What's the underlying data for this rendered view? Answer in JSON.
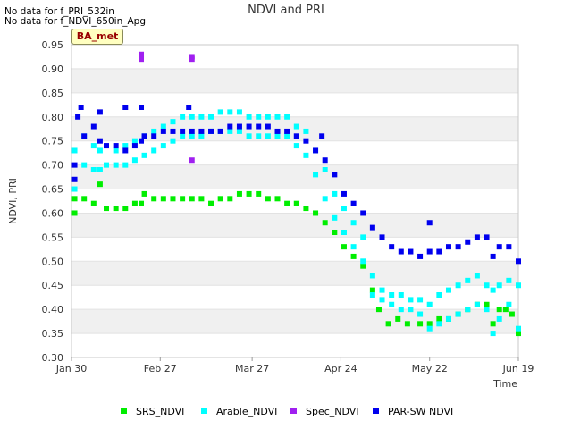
{
  "notes": [
    "No data for f_PRI_532in",
    "No data for f_NDVI_650in_Apg"
  ],
  "site_tag": "BA_met",
  "chart_data": {
    "type": "scatter",
    "title": "NDVI and PRI",
    "xlabel": "Time",
    "ylabel": "NDVI, PRI",
    "x_range": [
      "2024-01-30",
      "2024-06-19"
    ],
    "xticks": [
      {
        "label": "Jan 30",
        "date": "2024-01-30"
      },
      {
        "label": "Feb 27",
        "date": "2024-02-27"
      },
      {
        "label": "Mar 27",
        "date": "2024-03-27"
      },
      {
        "label": "Apr 24",
        "date": "2024-04-24"
      },
      {
        "label": "May 22",
        "date": "2024-05-22"
      },
      {
        "label": "Jun 19",
        "date": "2024-06-19"
      }
    ],
    "ylim": [
      0.3,
      0.95
    ],
    "yticks": [
      "0.30",
      "0.35",
      "0.40",
      "0.45",
      "0.50",
      "0.55",
      "0.60",
      "0.65",
      "0.70",
      "0.75",
      "0.80",
      "0.85",
      "0.90",
      "0.95"
    ],
    "grid": "horizontal alternating bands",
    "legend_position": "bottom",
    "series": [
      {
        "name": "SRS_NDVI",
        "color": "#00ee00",
        "points": [
          [
            "2024-01-31",
            0.6
          ],
          [
            "2024-01-31",
            0.63
          ],
          [
            "2024-02-03",
            0.63
          ],
          [
            "2024-02-06",
            0.62
          ],
          [
            "2024-02-08",
            0.66
          ],
          [
            "2024-02-10",
            0.61
          ],
          [
            "2024-02-13",
            0.61
          ],
          [
            "2024-02-16",
            0.61
          ],
          [
            "2024-02-19",
            0.62
          ],
          [
            "2024-02-21",
            0.62
          ],
          [
            "2024-02-22",
            0.64
          ],
          [
            "2024-02-25",
            0.63
          ],
          [
            "2024-02-28",
            0.63
          ],
          [
            "2024-03-02",
            0.63
          ],
          [
            "2024-03-05",
            0.63
          ],
          [
            "2024-03-08",
            0.63
          ],
          [
            "2024-03-11",
            0.63
          ],
          [
            "2024-03-14",
            0.62
          ],
          [
            "2024-03-17",
            0.63
          ],
          [
            "2024-03-20",
            0.63
          ],
          [
            "2024-03-23",
            0.64
          ],
          [
            "2024-03-26",
            0.64
          ],
          [
            "2024-03-29",
            0.64
          ],
          [
            "2024-04-01",
            0.63
          ],
          [
            "2024-04-04",
            0.63
          ],
          [
            "2024-04-07",
            0.62
          ],
          [
            "2024-04-10",
            0.62
          ],
          [
            "2024-04-13",
            0.61
          ],
          [
            "2024-04-16",
            0.6
          ],
          [
            "2024-04-19",
            0.58
          ],
          [
            "2024-04-22",
            0.56
          ],
          [
            "2024-04-25",
            0.53
          ],
          [
            "2024-04-28",
            0.51
          ],
          [
            "2024-05-01",
            0.49
          ],
          [
            "2024-05-04",
            0.44
          ],
          [
            "2024-05-06",
            0.4
          ],
          [
            "2024-05-09",
            0.37
          ],
          [
            "2024-05-12",
            0.38
          ],
          [
            "2024-05-15",
            0.37
          ],
          [
            "2024-05-19",
            0.37
          ],
          [
            "2024-05-22",
            0.37
          ],
          [
            "2024-05-25",
            0.38
          ],
          [
            "2024-05-28",
            0.38
          ],
          [
            "2024-05-31",
            0.39
          ],
          [
            "2024-06-03",
            0.4
          ],
          [
            "2024-06-06",
            0.41
          ],
          [
            "2024-06-09",
            0.41
          ],
          [
            "2024-06-11",
            0.37
          ],
          [
            "2024-06-13",
            0.4
          ],
          [
            "2024-06-15",
            0.4
          ],
          [
            "2024-06-17",
            0.39
          ],
          [
            "2024-06-19",
            0.35
          ]
        ]
      },
      {
        "name": "Arable_NDVI",
        "color": "#00ffff",
        "points": [
          [
            "2024-01-31",
            0.65
          ],
          [
            "2024-01-31",
            0.73
          ],
          [
            "2024-02-03",
            0.7
          ],
          [
            "2024-02-03",
            0.76
          ],
          [
            "2024-02-06",
            0.69
          ],
          [
            "2024-02-06",
            0.74
          ],
          [
            "2024-02-08",
            0.69
          ],
          [
            "2024-02-08",
            0.73
          ],
          [
            "2024-02-10",
            0.7
          ],
          [
            "2024-02-13",
            0.7
          ],
          [
            "2024-02-13",
            0.73
          ],
          [
            "2024-02-16",
            0.7
          ],
          [
            "2024-02-16",
            0.74
          ],
          [
            "2024-02-19",
            0.71
          ],
          [
            "2024-02-19",
            0.75
          ],
          [
            "2024-02-22",
            0.72
          ],
          [
            "2024-02-22",
            0.76
          ],
          [
            "2024-02-25",
            0.73
          ],
          [
            "2024-02-25",
            0.77
          ],
          [
            "2024-02-28",
            0.74
          ],
          [
            "2024-02-28",
            0.78
          ],
          [
            "2024-03-02",
            0.75
          ],
          [
            "2024-03-02",
            0.79
          ],
          [
            "2024-03-05",
            0.76
          ],
          [
            "2024-03-05",
            0.8
          ],
          [
            "2024-03-08",
            0.76
          ],
          [
            "2024-03-08",
            0.8
          ],
          [
            "2024-03-11",
            0.76
          ],
          [
            "2024-03-11",
            0.8
          ],
          [
            "2024-03-14",
            0.77
          ],
          [
            "2024-03-14",
            0.8
          ],
          [
            "2024-03-17",
            0.77
          ],
          [
            "2024-03-17",
            0.81
          ],
          [
            "2024-03-20",
            0.77
          ],
          [
            "2024-03-20",
            0.81
          ],
          [
            "2024-03-23",
            0.77
          ],
          [
            "2024-03-23",
            0.81
          ],
          [
            "2024-03-26",
            0.76
          ],
          [
            "2024-03-26",
            0.8
          ],
          [
            "2024-03-29",
            0.76
          ],
          [
            "2024-03-29",
            0.8
          ],
          [
            "2024-04-01",
            0.76
          ],
          [
            "2024-04-01",
            0.8
          ],
          [
            "2024-04-04",
            0.76
          ],
          [
            "2024-04-04",
            0.8
          ],
          [
            "2024-04-07",
            0.76
          ],
          [
            "2024-04-07",
            0.8
          ],
          [
            "2024-04-10",
            0.74
          ],
          [
            "2024-04-10",
            0.78
          ],
          [
            "2024-04-13",
            0.72
          ],
          [
            "2024-04-13",
            0.77
          ],
          [
            "2024-04-16",
            0.68
          ],
          [
            "2024-04-16",
            0.73
          ],
          [
            "2024-04-19",
            0.63
          ],
          [
            "2024-04-19",
            0.69
          ],
          [
            "2024-04-22",
            0.59
          ],
          [
            "2024-04-22",
            0.64
          ],
          [
            "2024-04-25",
            0.56
          ],
          [
            "2024-04-25",
            0.61
          ],
          [
            "2024-04-28",
            0.53
          ],
          [
            "2024-04-28",
            0.58
          ],
          [
            "2024-05-01",
            0.5
          ],
          [
            "2024-05-01",
            0.55
          ],
          [
            "2024-05-04",
            0.43
          ],
          [
            "2024-05-04",
            0.47
          ],
          [
            "2024-05-07",
            0.42
          ],
          [
            "2024-05-07",
            0.44
          ],
          [
            "2024-05-10",
            0.41
          ],
          [
            "2024-05-10",
            0.43
          ],
          [
            "2024-05-13",
            0.4
          ],
          [
            "2024-05-13",
            0.43
          ],
          [
            "2024-05-16",
            0.4
          ],
          [
            "2024-05-16",
            0.42
          ],
          [
            "2024-05-19",
            0.39
          ],
          [
            "2024-05-19",
            0.42
          ],
          [
            "2024-05-22",
            0.36
          ],
          [
            "2024-05-22",
            0.41
          ],
          [
            "2024-05-25",
            0.37
          ],
          [
            "2024-05-25",
            0.43
          ],
          [
            "2024-05-28",
            0.38
          ],
          [
            "2024-05-28",
            0.44
          ],
          [
            "2024-05-31",
            0.39
          ],
          [
            "2024-05-31",
            0.45
          ],
          [
            "2024-06-03",
            0.4
          ],
          [
            "2024-06-03",
            0.46
          ],
          [
            "2024-06-06",
            0.41
          ],
          [
            "2024-06-06",
            0.47
          ],
          [
            "2024-06-09",
            0.4
          ],
          [
            "2024-06-09",
            0.45
          ],
          [
            "2024-06-11",
            0.35
          ],
          [
            "2024-06-11",
            0.44
          ],
          [
            "2024-06-13",
            0.38
          ],
          [
            "2024-06-13",
            0.45
          ],
          [
            "2024-06-16",
            0.41
          ],
          [
            "2024-06-16",
            0.46
          ],
          [
            "2024-06-19",
            0.36
          ],
          [
            "2024-06-19",
            0.45
          ]
        ]
      },
      {
        "name": "Spec_NDVI",
        "color": "#a020f0",
        "points": [
          [
            "2024-02-21",
            0.92
          ],
          [
            "2024-02-21",
            0.93
          ],
          [
            "2024-03-08",
            0.92
          ],
          [
            "2024-03-08",
            0.925
          ],
          [
            "2024-03-08",
            0.71
          ]
        ]
      },
      {
        "name": "PAR-SW NDVI",
        "color": "#0000ee",
        "points": [
          [
            "2024-01-31",
            0.7
          ],
          [
            "2024-01-31",
            0.67
          ],
          [
            "2024-02-01",
            0.8
          ],
          [
            "2024-02-02",
            0.82
          ],
          [
            "2024-02-03",
            0.76
          ],
          [
            "2024-02-06",
            0.78
          ],
          [
            "2024-02-08",
            0.75
          ],
          [
            "2024-02-08",
            0.81
          ],
          [
            "2024-02-10",
            0.74
          ],
          [
            "2024-02-13",
            0.74
          ],
          [
            "2024-02-16",
            0.73
          ],
          [
            "2024-02-16",
            0.82
          ],
          [
            "2024-02-19",
            0.74
          ],
          [
            "2024-02-21",
            0.75
          ],
          [
            "2024-02-21",
            0.82
          ],
          [
            "2024-02-22",
            0.76
          ],
          [
            "2024-02-25",
            0.76
          ],
          [
            "2024-02-28",
            0.77
          ],
          [
            "2024-03-02",
            0.77
          ],
          [
            "2024-03-05",
            0.77
          ],
          [
            "2024-03-07",
            0.82
          ],
          [
            "2024-03-08",
            0.77
          ],
          [
            "2024-03-11",
            0.77
          ],
          [
            "2024-03-14",
            0.77
          ],
          [
            "2024-03-17",
            0.77
          ],
          [
            "2024-03-20",
            0.78
          ],
          [
            "2024-03-23",
            0.78
          ],
          [
            "2024-03-26",
            0.78
          ],
          [
            "2024-03-29",
            0.78
          ],
          [
            "2024-04-01",
            0.78
          ],
          [
            "2024-04-04",
            0.77
          ],
          [
            "2024-04-07",
            0.77
          ],
          [
            "2024-04-10",
            0.76
          ],
          [
            "2024-04-13",
            0.75
          ],
          [
            "2024-04-16",
            0.73
          ],
          [
            "2024-04-18",
            0.76
          ],
          [
            "2024-04-19",
            0.71
          ],
          [
            "2024-04-22",
            0.68
          ],
          [
            "2024-04-25",
            0.64
          ],
          [
            "2024-04-28",
            0.62
          ],
          [
            "2024-05-01",
            0.6
          ],
          [
            "2024-05-04",
            0.57
          ],
          [
            "2024-05-07",
            0.55
          ],
          [
            "2024-05-10",
            0.53
          ],
          [
            "2024-05-13",
            0.52
          ],
          [
            "2024-05-16",
            0.52
          ],
          [
            "2024-05-19",
            0.51
          ],
          [
            "2024-05-22",
            0.52
          ],
          [
            "2024-05-22",
            0.58
          ],
          [
            "2024-05-25",
            0.52
          ],
          [
            "2024-05-28",
            0.53
          ],
          [
            "2024-05-31",
            0.53
          ],
          [
            "2024-06-03",
            0.54
          ],
          [
            "2024-06-06",
            0.55
          ],
          [
            "2024-06-09",
            0.55
          ],
          [
            "2024-06-11",
            0.51
          ],
          [
            "2024-06-13",
            0.53
          ],
          [
            "2024-06-16",
            0.53
          ],
          [
            "2024-06-19",
            0.5
          ]
        ]
      }
    ]
  }
}
